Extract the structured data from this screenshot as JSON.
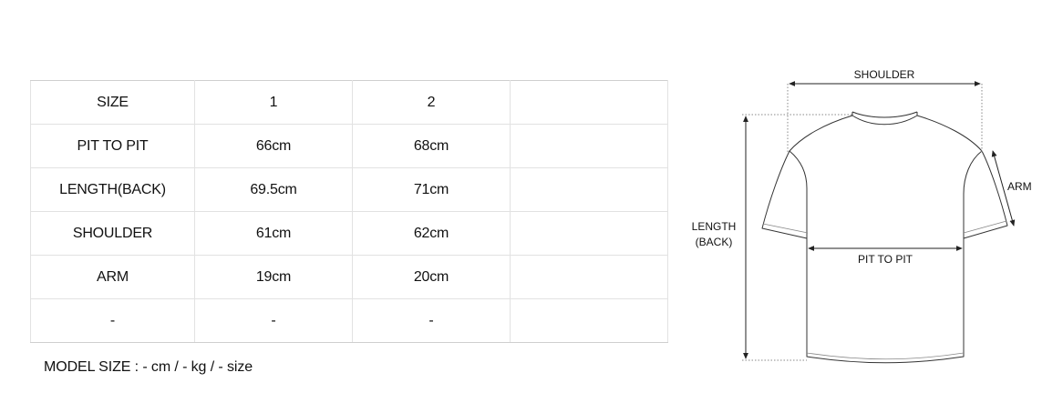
{
  "size_table": {
    "rows": [
      [
        "SIZE",
        "1",
        "2",
        ""
      ],
      [
        "PIT TO PIT",
        "66cm",
        "68cm",
        ""
      ],
      [
        "LENGTH(BACK)",
        "69.5cm",
        "71cm",
        ""
      ],
      [
        "SHOULDER",
        "61cm",
        "62cm",
        ""
      ],
      [
        "ARM",
        "19cm",
        "20cm",
        ""
      ],
      [
        "-",
        "-",
        "-",
        ""
      ]
    ]
  },
  "model_note": "MODEL SIZE : - cm / - kg / - size",
  "diagram": {
    "shoulder_label": "SHOULDER",
    "arm_label": "ARM",
    "length_label_line1": "LENGTH",
    "length_label_line2": "(BACK)",
    "pit_label": "PIT TO PIT"
  }
}
